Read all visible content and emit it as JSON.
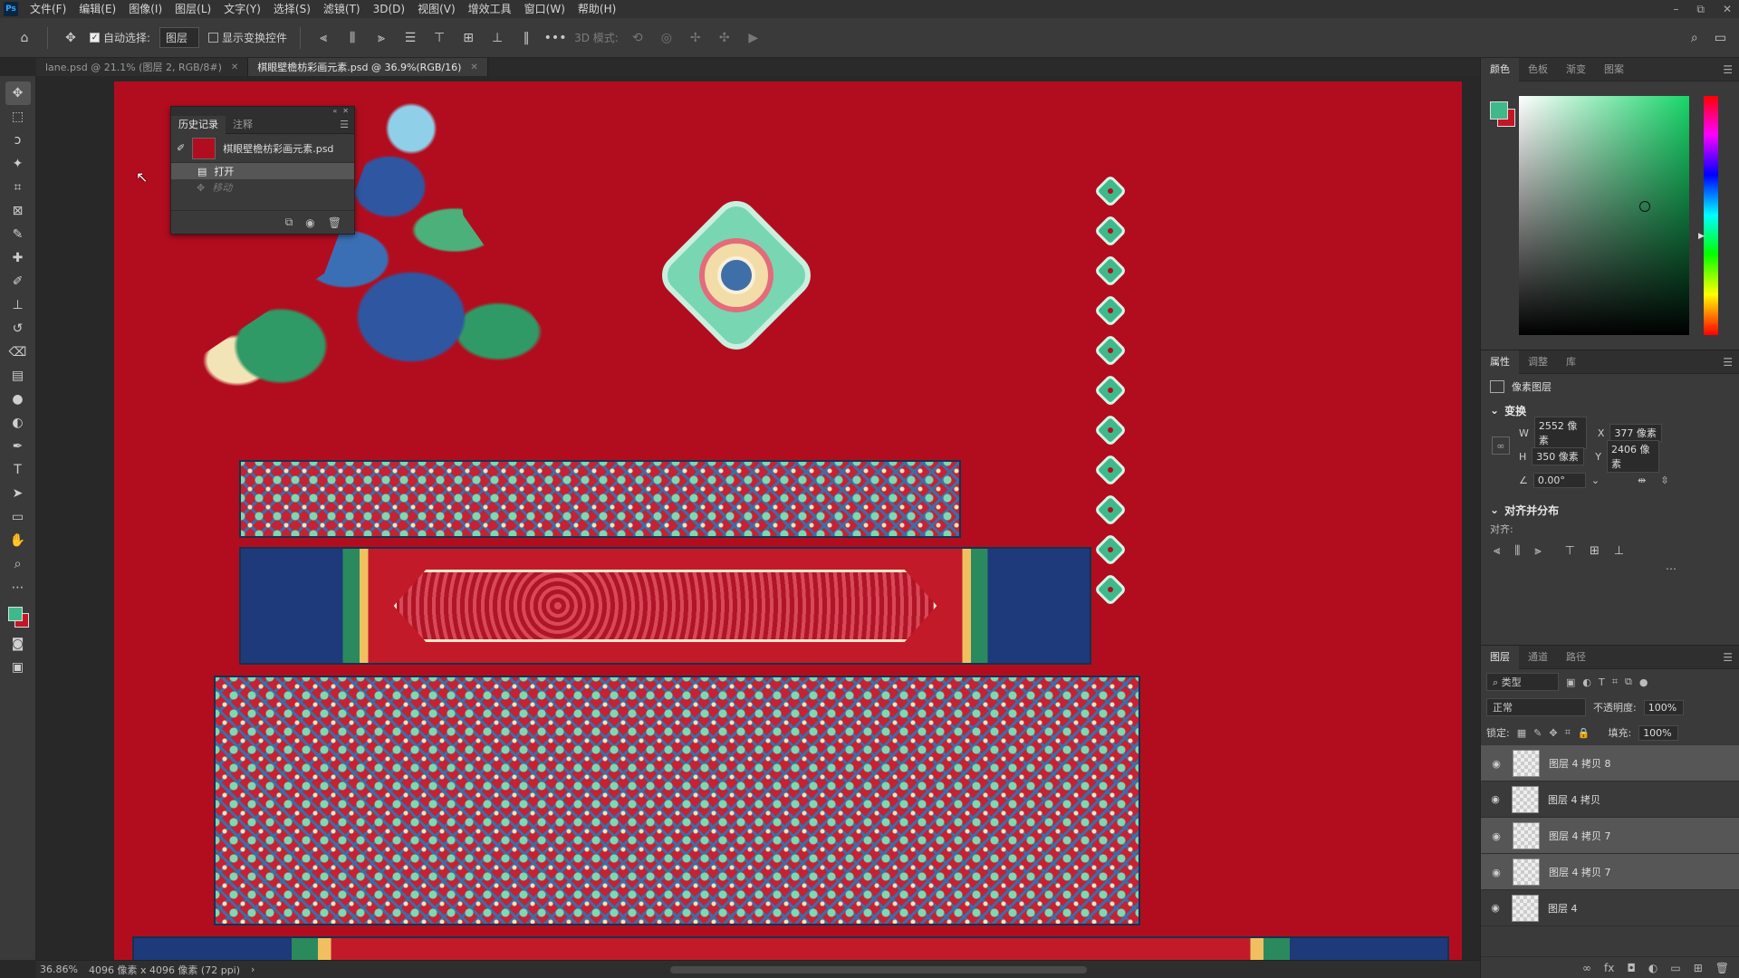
{
  "app": {
    "logo": "Ps"
  },
  "menu": [
    "文件(F)",
    "编辑(E)",
    "图像(I)",
    "图层(L)",
    "文字(Y)",
    "选择(S)",
    "滤镜(T)",
    "3D(D)",
    "视图(V)",
    "增效工具",
    "窗口(W)",
    "帮助(H)"
  ],
  "window_controls": [
    "–",
    "⧉",
    "✕"
  ],
  "options": {
    "auto_select_label": "自动选择:",
    "auto_select_value": "图层",
    "show_transform_label": "显示变换控件",
    "mode_3d_label": "3D 模式:",
    "more": "•••"
  },
  "tabs": [
    {
      "label": "lane.psd @ 21.1% (图层 2, RGB/8#)",
      "active": false
    },
    {
      "label": "棋眼壁檐枋彩画元素.psd @ 36.9%(RGB/16)",
      "active": true
    }
  ],
  "history": {
    "tabs": [
      "历史记录",
      "注释"
    ],
    "snapshot": "棋眼壁檐枋彩画元素.psd",
    "items": [
      {
        "label": "打开",
        "state": "selected"
      },
      {
        "label": "移动",
        "state": "dimmed"
      }
    ]
  },
  "status": {
    "zoom": "36.86%",
    "doc_size": "4096 像素 x 4096 像素 (72 ppi)",
    "arrow": "›"
  },
  "color_panel": {
    "tabs": [
      "颜色",
      "色板",
      "渐变",
      "图案"
    ],
    "foreground": "#3fb98a",
    "background": "#c21627"
  },
  "properties": {
    "tabs": [
      "属性",
      "调整",
      "库"
    ],
    "kind": "像素图层",
    "transform_title": "变换",
    "w_label": "W",
    "w": "2552 像素",
    "h_label": "H",
    "h": "350 像素",
    "x_label": "X",
    "x": "377 像素",
    "y_label": "Y",
    "y": "2406 像素",
    "angle": "0.00°",
    "align_title": "对齐并分布",
    "align_label": "对齐:"
  },
  "layers": {
    "tabs": [
      "图层",
      "通道",
      "路径"
    ],
    "filter": "类型",
    "blend": "正常",
    "opacity_label": "不透明度:",
    "opacity": "100%",
    "lock_label": "锁定:",
    "fill_label": "填充:",
    "fill": "100%",
    "items": [
      {
        "name": "图层 4 拷贝 8",
        "selected": true
      },
      {
        "name": "图层 4 拷贝",
        "selected": false
      },
      {
        "name": "图层 4 拷贝 7",
        "selected": true
      },
      {
        "name": "图层 4 拷贝 7",
        "selected": true
      },
      {
        "name": "图层 4",
        "selected": false
      }
    ]
  },
  "colors": {
    "canvas_bg": "#b20d1f",
    "accent_green": "#3fb98a",
    "panel_bg": "#3a3a3a"
  }
}
